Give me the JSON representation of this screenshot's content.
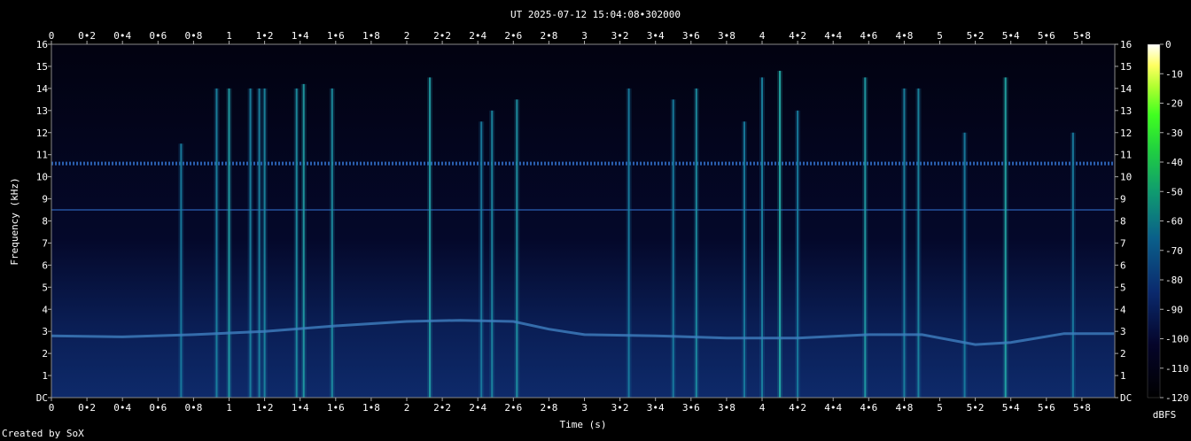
{
  "chart_data": {
    "type": "heatmap",
    "title": "UT 2025-07-12 15:04:08•302000",
    "xlabel": "Time (s)",
    "ylabel": "Frequency (kHz)",
    "xlim": [
      0,
      5.98
    ],
    "ylim": [
      0,
      16
    ],
    "x_ticks": [
      "0",
      "0•2",
      "0•4",
      "0•6",
      "0•8",
      "1",
      "1•2",
      "1•4",
      "1•6",
      "1•8",
      "2",
      "2•2",
      "2•4",
      "2•6",
      "2•8",
      "3",
      "3•2",
      "3•4",
      "3•6",
      "3•8",
      "4",
      "4•2",
      "4•4",
      "4•6",
      "4•8",
      "5",
      "5•2",
      "5•4",
      "5•6",
      "5•8"
    ],
    "y_ticks": [
      "DC",
      "1",
      "2",
      "3",
      "4",
      "5",
      "6",
      "7",
      "8",
      "9",
      "10",
      "11",
      "12",
      "13",
      "14",
      "15",
      "16"
    ],
    "colorbar": {
      "label": "dBFS",
      "ticks": [
        "0",
        "-10",
        "-20",
        "-30",
        "-40",
        "-50",
        "-60",
        "-70",
        "-80",
        "-90",
        "-100",
        "-110",
        "-120"
      ],
      "range": [
        -120,
        0
      ]
    },
    "stationary_tones_khz": [
      10.6,
      8.5
    ],
    "tracking_tone": {
      "t": [
        0,
        0.4,
        0.8,
        1.2,
        1.6,
        2.0,
        2.3,
        2.6,
        2.8,
        3.0,
        3.4,
        3.8,
        4.2,
        4.6,
        4.9,
        5.2,
        5.4,
        5.7,
        5.98
      ],
      "f_khz": [
        2.8,
        2.75,
        2.85,
        3.0,
        3.25,
        3.45,
        3.5,
        3.45,
        3.1,
        2.85,
        2.8,
        2.7,
        2.7,
        2.85,
        2.85,
        2.4,
        2.5,
        2.9,
        2.9
      ]
    },
    "transients": [
      {
        "t": 0.73,
        "fmax": 11.5,
        "level": -88
      },
      {
        "t": 0.93,
        "fmax": 14.0,
        "level": -85
      },
      {
        "t": 1.0,
        "fmax": 14.0,
        "level": -72
      },
      {
        "t": 1.12,
        "fmax": 14.0,
        "level": -86
      },
      {
        "t": 1.17,
        "fmax": 14.0,
        "level": -85
      },
      {
        "t": 1.2,
        "fmax": 14.0,
        "level": -84
      },
      {
        "t": 1.38,
        "fmax": 14.0,
        "level": -80
      },
      {
        "t": 1.42,
        "fmax": 14.2,
        "level": -74
      },
      {
        "t": 1.58,
        "fmax": 14.0,
        "level": -80
      },
      {
        "t": 2.13,
        "fmax": 14.5,
        "level": -72
      },
      {
        "t": 2.42,
        "fmax": 12.5,
        "level": -88
      },
      {
        "t": 2.48,
        "fmax": 13.0,
        "level": -84
      },
      {
        "t": 2.62,
        "fmax": 13.5,
        "level": -78
      },
      {
        "t": 3.25,
        "fmax": 14.0,
        "level": -88
      },
      {
        "t": 3.5,
        "fmax": 13.5,
        "level": -88
      },
      {
        "t": 3.63,
        "fmax": 14.0,
        "level": -80
      },
      {
        "t": 3.9,
        "fmax": 12.5,
        "level": -88
      },
      {
        "t": 4.0,
        "fmax": 14.5,
        "level": -86
      },
      {
        "t": 4.1,
        "fmax": 14.8,
        "level": -66
      },
      {
        "t": 4.2,
        "fmax": 13.0,
        "level": -88
      },
      {
        "t": 4.58,
        "fmax": 14.5,
        "level": -74
      },
      {
        "t": 4.8,
        "fmax": 14.0,
        "level": -86
      },
      {
        "t": 4.88,
        "fmax": 14.0,
        "level": -84
      },
      {
        "t": 5.14,
        "fmax": 12.0,
        "level": -88
      },
      {
        "t": 5.37,
        "fmax": 14.5,
        "level": -68
      },
      {
        "t": 5.75,
        "fmax": 12.0,
        "level": -88
      }
    ],
    "grid": false
  },
  "credit": "Created by SoX"
}
